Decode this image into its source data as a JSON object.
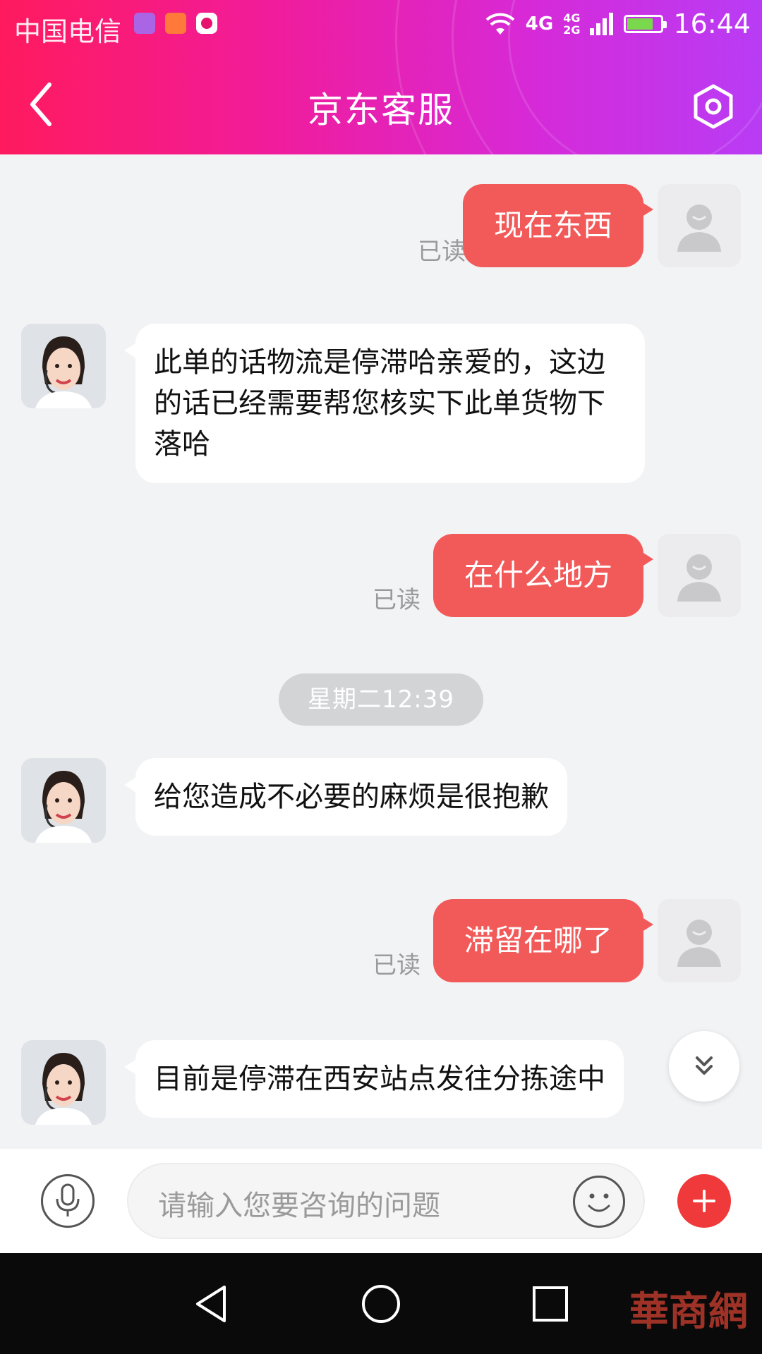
{
  "status_bar": {
    "carrier": "中国电信",
    "network_primary": "4G",
    "network_secondary_top": "4G",
    "network_secondary_bottom": "2G",
    "time": "16:44"
  },
  "header": {
    "title": "京东客服",
    "back_icon": "chevron-left-icon",
    "settings_icon": "hexagon-gear-icon"
  },
  "messages": [
    {
      "sender": "user",
      "text": "现在东西",
      "status": "已读"
    },
    {
      "sender": "agent",
      "lines": [
        "此单的话物流是停滞哈亲爱的，这边",
        "的话已经需要帮您核实下此单货物下",
        "落哈"
      ]
    },
    {
      "sender": "user",
      "text": "在什么地方",
      "status": "已读"
    },
    {
      "sender": "system",
      "text": "星期二12:39"
    },
    {
      "sender": "agent",
      "lines": [
        "给您造成不必要的麻烦是很抱歉"
      ]
    },
    {
      "sender": "user",
      "text": "滞留在哪了",
      "status": "已读"
    },
    {
      "sender": "agent",
      "lines": [
        "目前是停滞在西安站点发往分拣途中"
      ]
    }
  ],
  "input": {
    "placeholder": "请输入您要咨询的问题"
  },
  "watermark": {
    "text": "華商網"
  },
  "colors": {
    "header_gradient_start": "#ff1a5e",
    "header_gradient_end": "#b83cf5",
    "user_bubble": "#f25a5a",
    "agent_bubble": "#ffffff",
    "plus_button": "#f0393a",
    "background": "#f2f3f5"
  }
}
